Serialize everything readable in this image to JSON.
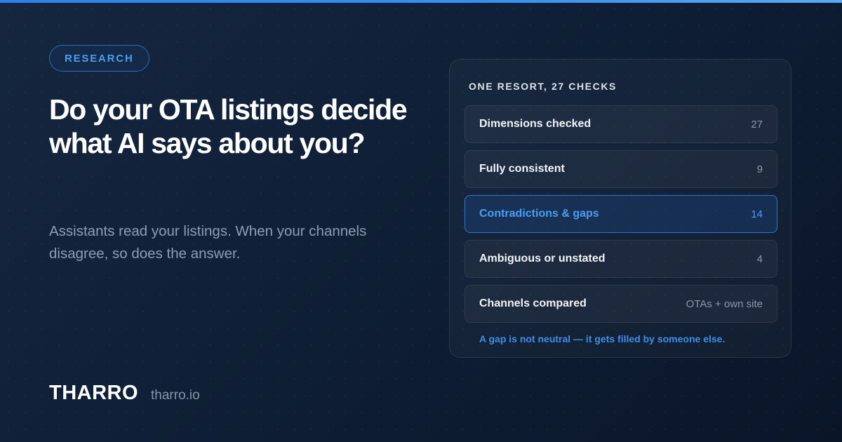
{
  "badge": {
    "label": "RESEARCH"
  },
  "headline": "Do your OTA listings decide what AI says about you?",
  "subhead": "Assistants read your listings. When your channels disagree, so does the answer.",
  "brand": {
    "name": "THARRO",
    "domain": "tharro.io"
  },
  "panel": {
    "title": "ONE RESORT, 27 CHECKS",
    "rows": [
      {
        "label": "Dimensions checked",
        "value": "27"
      },
      {
        "label": "Fully consistent",
        "value": "9"
      },
      {
        "label": "Contradictions & gaps",
        "value": "14",
        "highlighted": true
      },
      {
        "label": "Ambiguous or unstated",
        "value": "4"
      },
      {
        "label": "Channels compared",
        "value": "OTAs + own site"
      }
    ],
    "footnote": "A gap is not neutral — it gets filled by someone else."
  },
  "colors": {
    "accent": "#2f80ed",
    "highlight_text": "#4a9ef5",
    "background": "#0f1f37"
  }
}
